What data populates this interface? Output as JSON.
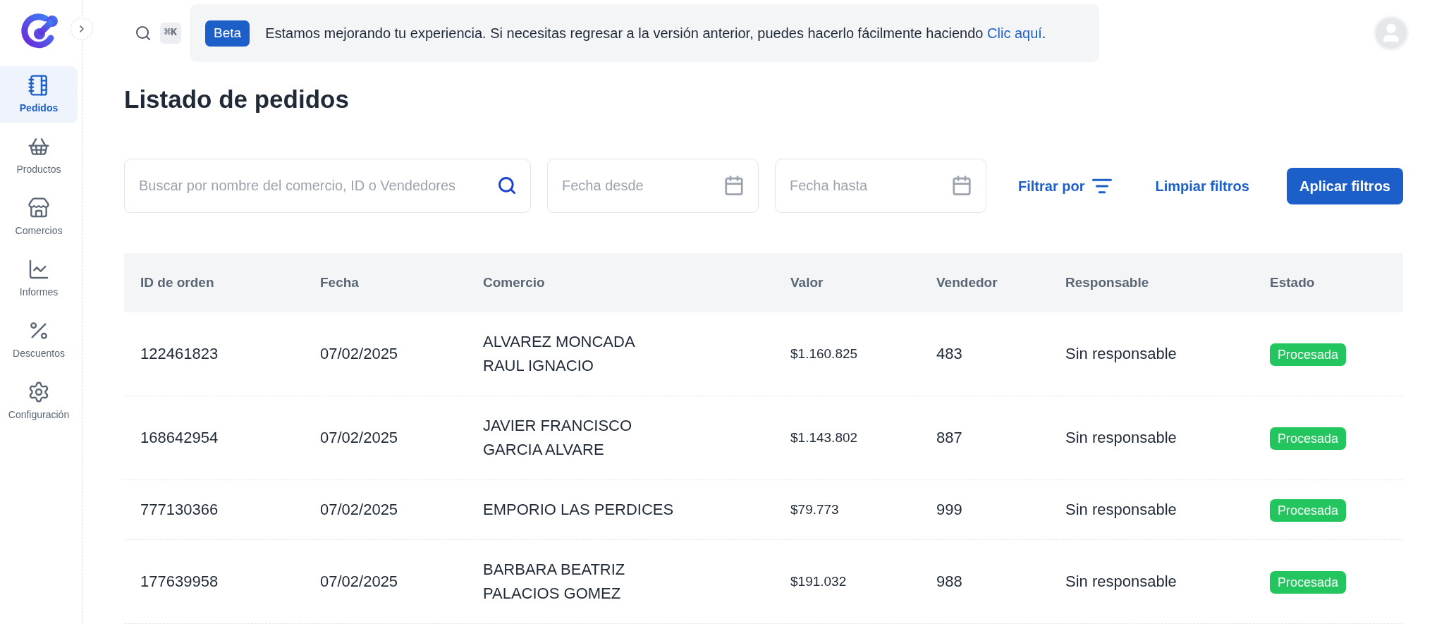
{
  "sidebar": {
    "items": [
      {
        "label": "Pedidos",
        "kind": "orders",
        "selected": true
      },
      {
        "label": "Productos",
        "kind": "products",
        "selected": false
      },
      {
        "label": "Comercios",
        "kind": "merchants",
        "selected": false
      },
      {
        "label": "Informes",
        "kind": "reports",
        "selected": false
      },
      {
        "label": "Descuentos",
        "kind": "discounts",
        "selected": false
      },
      {
        "label": "Configuración",
        "kind": "settings",
        "selected": false
      }
    ]
  },
  "topbar": {
    "shortcut": "⌘K",
    "banner": {
      "badge": "Beta",
      "message": "Estamos mejorando tu experiencia. Si necesitas regresar a la versión anterior, puedes hacerlo fácilmente haciendo",
      "link": "Clic aquí",
      "after_link": "."
    }
  },
  "title": "Listado de pedidos",
  "filters": {
    "search_placeholder": "Buscar por nombre del comercio, ID o Vendedores",
    "date_from_placeholder": "Fecha desde",
    "date_to_placeholder": "Fecha hasta",
    "filter_by": "Filtrar por",
    "clear": "Limpiar filtros",
    "apply": "Aplicar filtros"
  },
  "table": {
    "columns": [
      "ID de orden",
      "Fecha",
      "Comercio",
      "Valor",
      "Vendedor",
      "Responsable",
      "Estado"
    ],
    "rows": [
      {
        "id": "122461823",
        "date": "07/02/2025",
        "merchant": [
          "ALVAREZ MONCADA",
          "RAUL IGNACIO"
        ],
        "value": "$1.160.825",
        "seller": "483",
        "responsible": "Sin responsable",
        "status": "Procesada"
      },
      {
        "id": "168642954",
        "date": "07/02/2025",
        "merchant": [
          "JAVIER FRANCISCO",
          "GARCIA ALVARE"
        ],
        "value": "$1.143.802",
        "seller": "887",
        "responsible": "Sin responsable",
        "status": "Procesada"
      },
      {
        "id": "777130366",
        "date": "07/02/2025",
        "merchant": [
          "EMPORIO LAS PERDICES"
        ],
        "value": "$79.773",
        "seller": "999",
        "responsible": "Sin responsable",
        "status": "Procesada"
      },
      {
        "id": "177639958",
        "date": "07/02/2025",
        "merchant": [
          "BARBARA BEATRIZ",
          "PALACIOS GOMEZ"
        ],
        "value": "$191.032",
        "seller": "988",
        "responsible": "Sin responsable",
        "status": "Procesada"
      }
    ]
  }
}
